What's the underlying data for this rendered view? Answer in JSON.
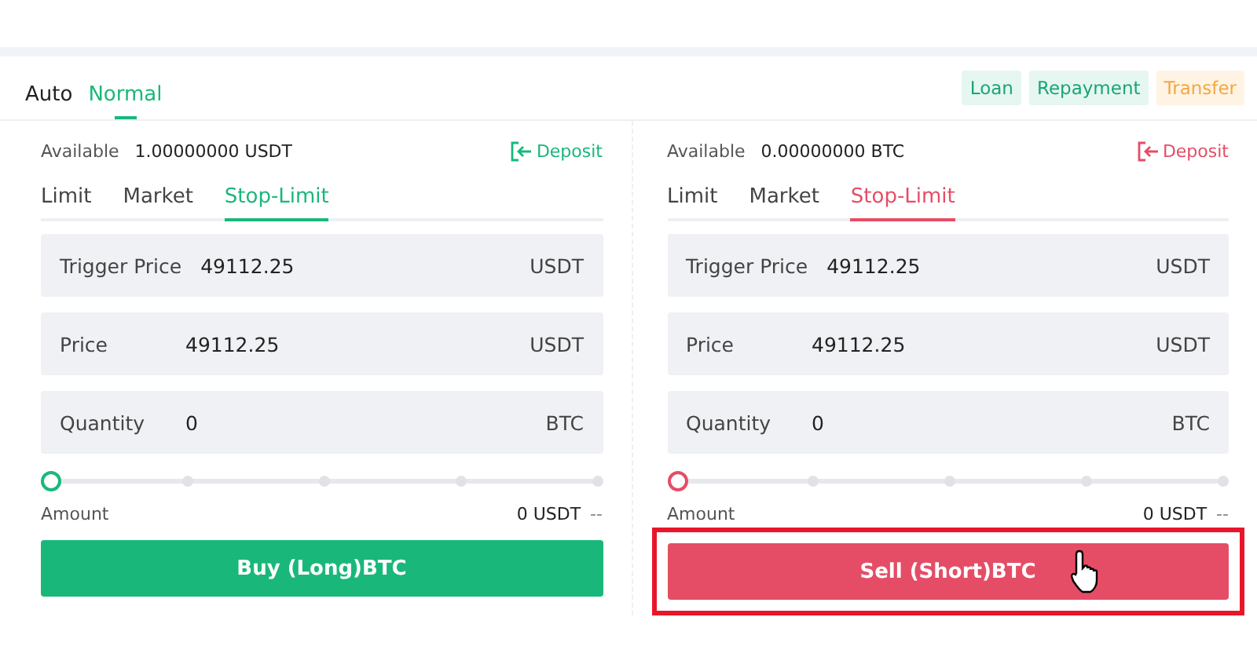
{
  "mode_tabs": [
    {
      "label": "Auto",
      "selected": false
    },
    {
      "label": "Normal",
      "selected": true
    }
  ],
  "actions": [
    {
      "label": "Loan",
      "kind": "green"
    },
    {
      "label": "Repayment",
      "kind": "green"
    },
    {
      "label": "Transfer",
      "kind": "orange"
    }
  ],
  "panels": [
    {
      "color": "#19b87a",
      "available_label": "Available",
      "available": "1.00000000 USDT",
      "deposit": "Deposit",
      "order_tabs": [
        {
          "label": "Limit",
          "selected": false
        },
        {
          "label": "Market",
          "selected": false
        },
        {
          "label": "Stop-Limit",
          "selected": true
        }
      ],
      "fields": [
        {
          "label": "Trigger Price",
          "value": "49112.25",
          "unit": "USDT"
        },
        {
          "label": "Price",
          "value": "49112.25",
          "unit": "USDT"
        },
        {
          "label": "Quantity",
          "value": "0",
          "unit": "BTC"
        }
      ],
      "slider": {
        "level": 0
      },
      "amount_label": "Amount",
      "amount": "0 USDT",
      "amount_extra": "--",
      "button": "Buy (Long)BTC",
      "highlighted": false,
      "pointer": false
    },
    {
      "color": "#e54d66",
      "available_label": "Available",
      "available": "0.00000000 BTC",
      "deposit": "Deposit",
      "order_tabs": [
        {
          "label": "Limit",
          "selected": false
        },
        {
          "label": "Market",
          "selected": false
        },
        {
          "label": "Stop-Limit",
          "selected": true
        }
      ],
      "fields": [
        {
          "label": "Trigger Price",
          "value": "49112.25",
          "unit": "USDT"
        },
        {
          "label": "Price",
          "value": "49112.25",
          "unit": "USDT"
        },
        {
          "label": "Quantity",
          "value": "0",
          "unit": "BTC"
        }
      ],
      "slider": {
        "level": 0
      },
      "amount_label": "Amount",
      "amount": "0 USDT",
      "amount_extra": "--",
      "button": "Sell (Short)BTC",
      "highlighted": true,
      "pointer": true
    }
  ]
}
